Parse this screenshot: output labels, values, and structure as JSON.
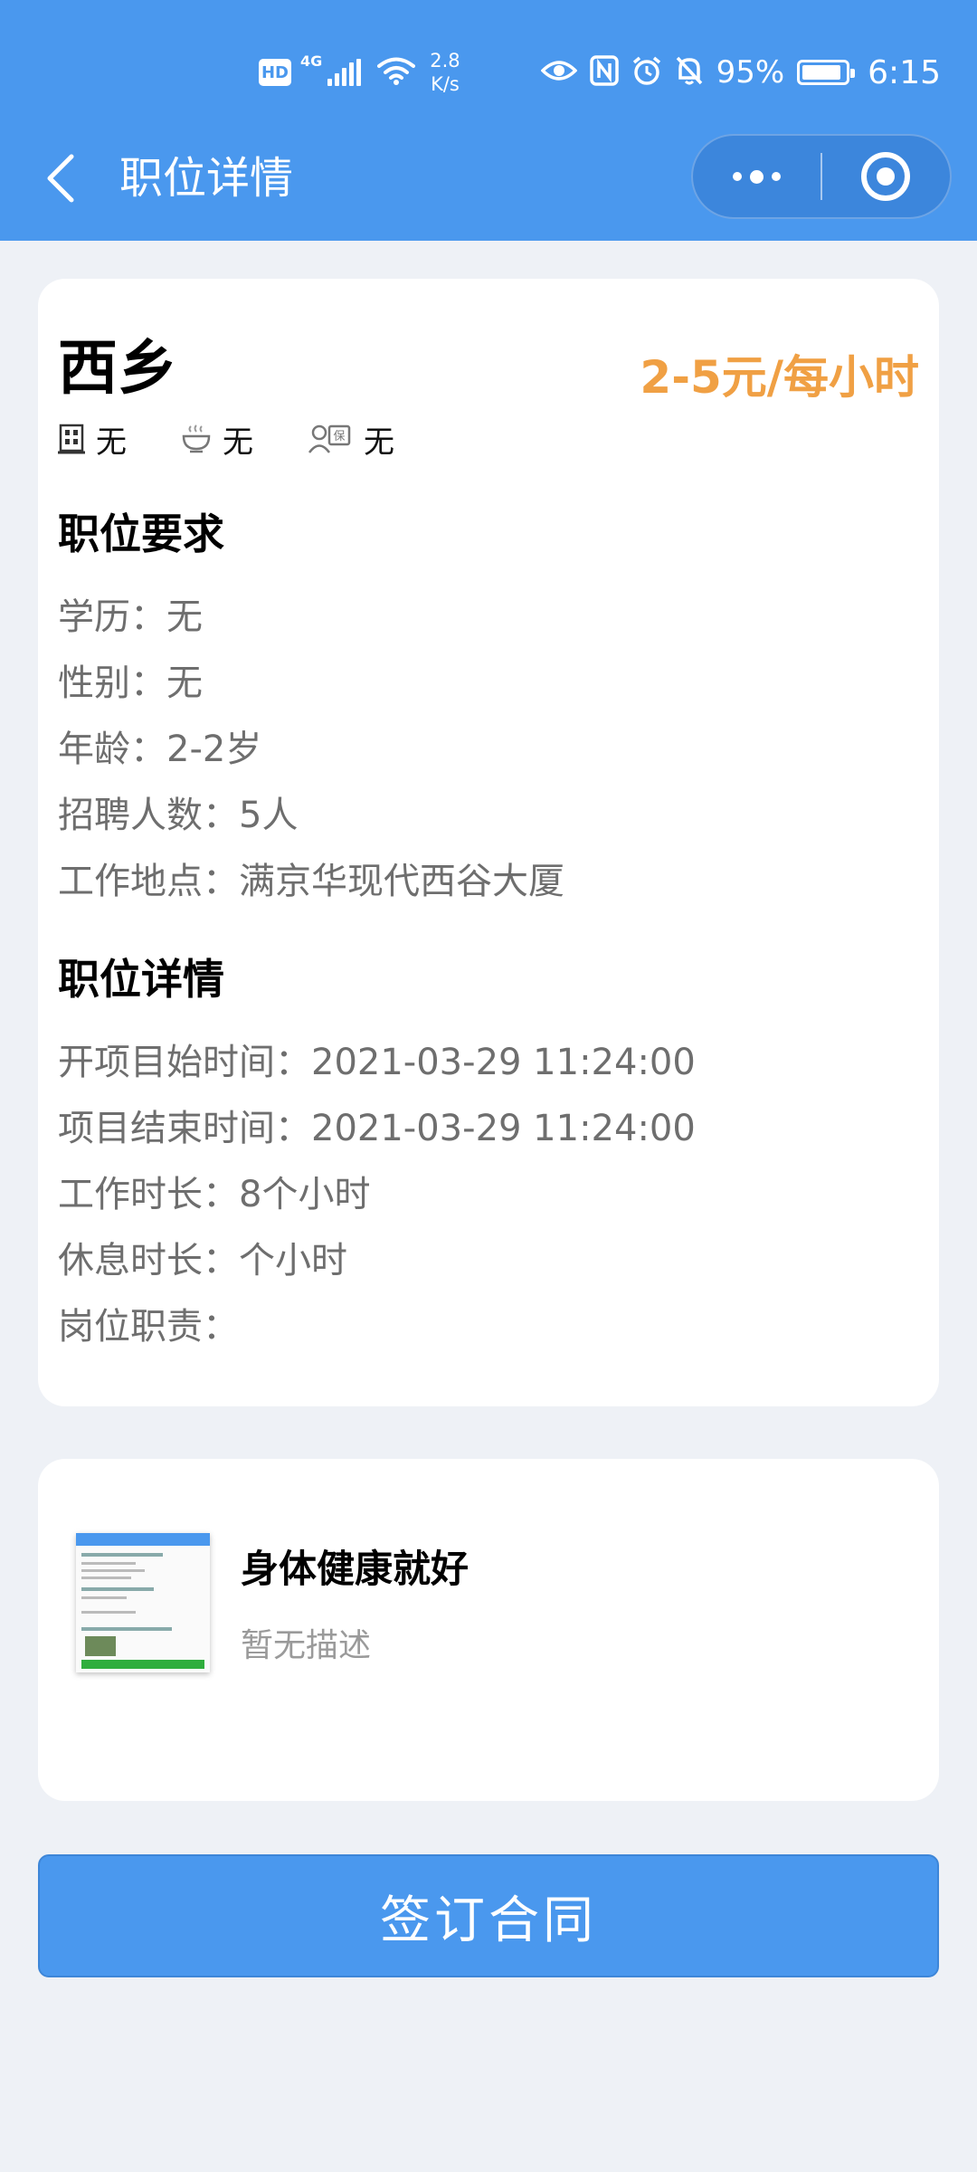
{
  "status_bar": {
    "hd": "HD",
    "network": "4G",
    "speed_value": "2.8",
    "speed_unit": "K/s",
    "battery": "95%",
    "time": "6:15"
  },
  "nav": {
    "title": "职位详情",
    "icons": [
      "chevron-left-icon",
      "more-icon",
      "target-circle-icon"
    ]
  },
  "job": {
    "title": "西乡",
    "salary": "2-5元/每小时",
    "perks": [
      {
        "icon": "building-icon",
        "label": "无"
      },
      {
        "icon": "meal-bowl-icon",
        "label": "无"
      },
      {
        "icon": "insurance-person-icon",
        "label": "无"
      }
    ],
    "requirements_heading": "职位要求",
    "requirements": [
      {
        "label": "学历：",
        "value": "无"
      },
      {
        "label": "性别：",
        "value": "无"
      },
      {
        "label": "年龄：",
        "value": "2-2岁"
      },
      {
        "label": "招聘人数：",
        "value": "5人"
      },
      {
        "label": "工作地点：",
        "value": "满京华现代西谷大厦"
      }
    ],
    "details_heading": "职位详情",
    "details": [
      {
        "label": "开项目始时间：",
        "value": "2021-03-29 11:24:00"
      },
      {
        "label": "项目结束时间：",
        "value": "2021-03-29 11:24:00"
      },
      {
        "label": "工作时长：",
        "value": "8个小时"
      },
      {
        "label": "休息时长：",
        "value": "个小时"
      },
      {
        "label": "岗位职责：",
        "value": ""
      }
    ]
  },
  "contract": {
    "title": "身体健康就好",
    "description": "暂无描述"
  },
  "actions": {
    "sign_label": "签订合同"
  },
  "colors": {
    "primary": "#4a98ee",
    "salary": "#f0a044",
    "background": "#eef1f6"
  }
}
